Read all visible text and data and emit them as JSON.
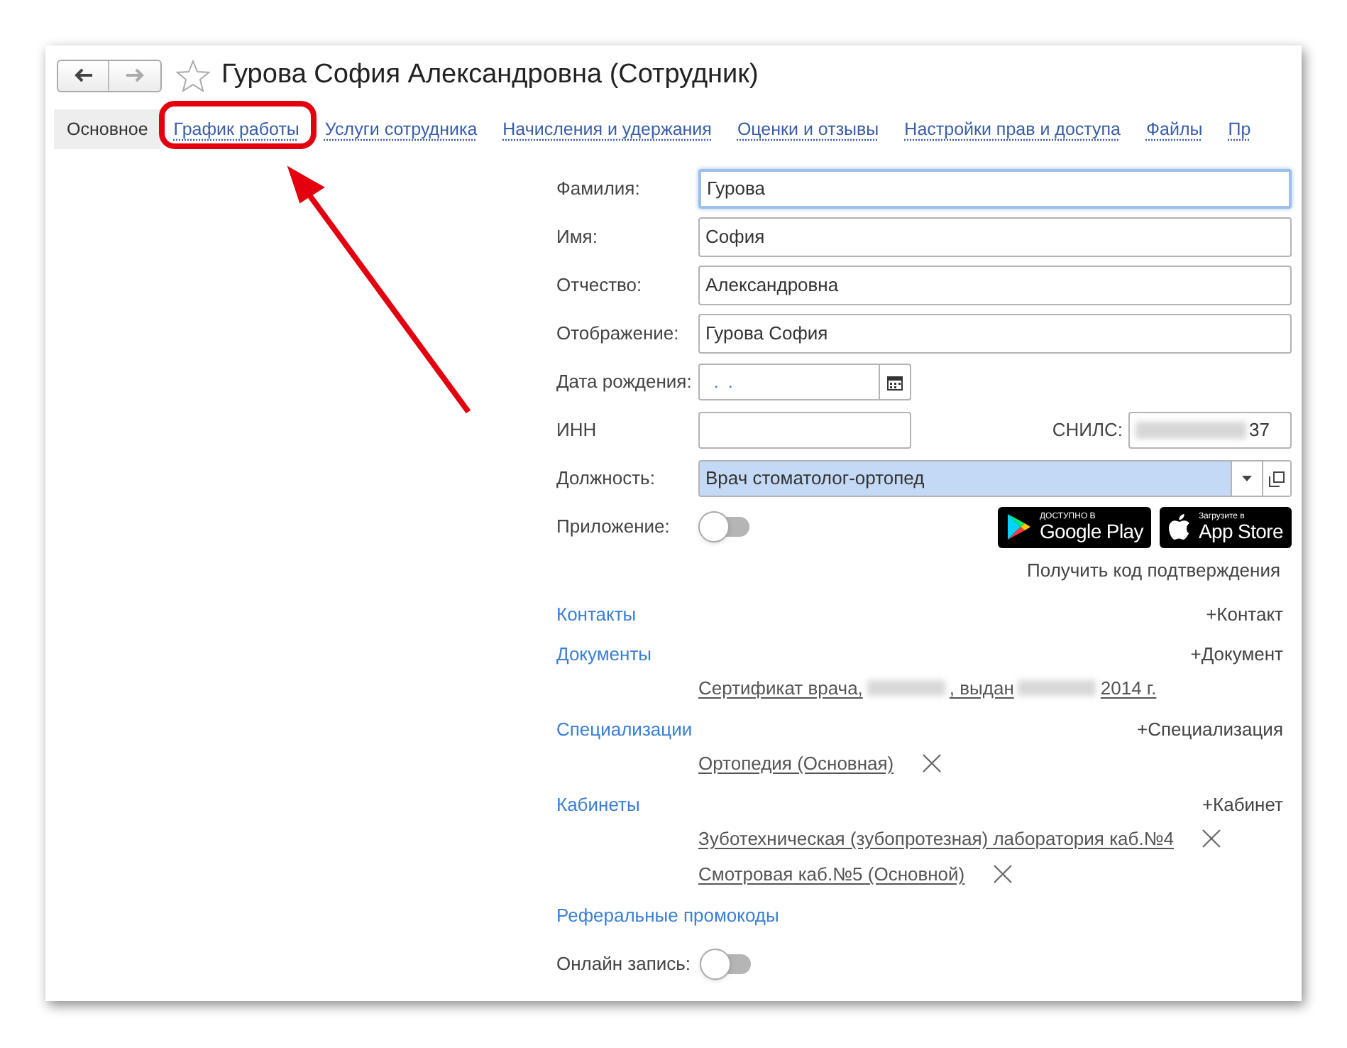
{
  "window": {
    "title": "Гурова София Александровна (Сотрудник)",
    "favorite": false
  },
  "tabs": [
    {
      "label": "Основное",
      "selected": true
    },
    {
      "label": "График работы",
      "selected": false
    },
    {
      "label": "Услуги сотрудника",
      "selected": false
    },
    {
      "label": "Начисления и удержания",
      "selected": false
    },
    {
      "label": "Оценки и отзывы",
      "selected": false
    },
    {
      "label": "Настройки прав и доступа",
      "selected": false
    },
    {
      "label": "Файлы",
      "selected": false
    },
    {
      "label": "Пр",
      "selected": false
    }
  ],
  "fields": [
    {
      "kind": "text",
      "label": "Фамилия:",
      "value": "Гурова",
      "focused": true
    },
    {
      "kind": "text",
      "label": "Имя:",
      "value": "София",
      "focused": false
    },
    {
      "kind": "text",
      "label": "Отчество:",
      "value": "Александровна",
      "focused": false
    },
    {
      "kind": "text",
      "label": "Отображение:",
      "value": "Гурова София",
      "focused": false
    },
    {
      "kind": "date",
      "label": "Дата рождения:",
      "value": ".  ."
    },
    {
      "kind": "inn",
      "label": "ИНН",
      "snils_label": "СНИЛС:",
      "snils_value": "37"
    },
    {
      "kind": "select",
      "label": "Должность:",
      "value": "Врач стоматолог-ортопед",
      "highlighted": true
    },
    {
      "kind": "toggle",
      "label": "Приложение:",
      "on": false
    }
  ],
  "store_badges": [
    {
      "kind": "google",
      "caption": "ДОСТУПНО В",
      "name": "Google Play"
    },
    {
      "kind": "apple",
      "caption": "Загрузите в",
      "name": "App Store"
    }
  ],
  "confirm_link": "Получить код подтверждения",
  "sections": [
    {
      "title": "Контакты",
      "add": "+Контакт"
    },
    {
      "title": "Документы",
      "add": "+Документ",
      "items": [
        {
          "parts": [
            "Сертификат врача,",
            ", выдан",
            "2014 г."
          ],
          "removable": false
        }
      ]
    },
    {
      "title": "Специализации",
      "add": "+Специализация",
      "items": [
        {
          "parts": [
            "Ортопедия (Основная)"
          ],
          "removable": true
        }
      ]
    },
    {
      "title": "Кабинеты",
      "add": "+Кабинет",
      "items": [
        {
          "parts": [
            "Зуботехническая (зубопротезная) лаборатория каб.№4"
          ],
          "removable": true
        },
        {
          "parts": [
            "Смотровая каб.№5 (Основной)"
          ],
          "removable": true
        }
      ]
    },
    {
      "title": "Реферальные промокоды"
    }
  ],
  "online_booking": {
    "label": "Онлайн запись:",
    "on": false
  }
}
